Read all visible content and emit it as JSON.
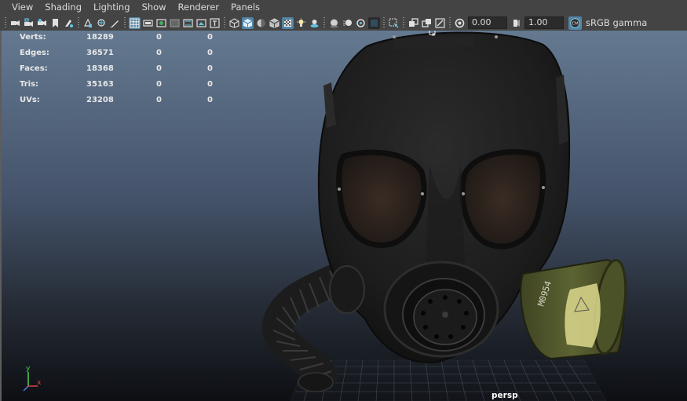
{
  "menu": [
    "View",
    "Shading",
    "Lighting",
    "Show",
    "Renderer",
    "Panels"
  ],
  "toolbar": {
    "exposure_value": "0.00",
    "gamma_value": "1.00",
    "color_management_label": "sRGB gamma",
    "cm_badge": "CM"
  },
  "hud": {
    "rows": [
      {
        "label": "Verts:",
        "total": "18289",
        "selected": "0",
        "component": "0"
      },
      {
        "label": "Edges:",
        "total": "36571",
        "selected": "0",
        "component": "0"
      },
      {
        "label": "Faces:",
        "total": "18368",
        "selected": "0",
        "component": "0"
      },
      {
        "label": "Tris:",
        "total": "35163",
        "selected": "0",
        "component": "0"
      },
      {
        "label": "UVs:",
        "total": "23208",
        "selected": "0",
        "component": "0"
      }
    ]
  },
  "viewport": {
    "camera_name": "persp",
    "axis_y_label": "y",
    "axis_x_label": "x",
    "filter_marking": "M0954"
  },
  "colors": {
    "ui_bg": "#444444",
    "toggle_active": "#5285a6",
    "viewport_top": "#647990",
    "viewport_bottom": "#0d0f13",
    "filter_olive": "#5c6332",
    "filter_label": "#d8d58a"
  }
}
